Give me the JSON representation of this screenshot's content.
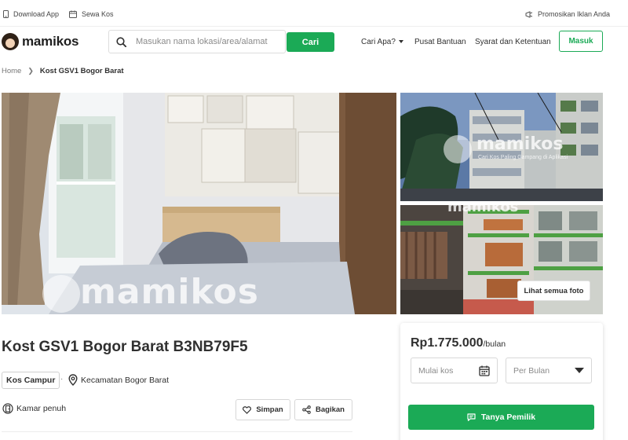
{
  "topbar": {
    "download_label": "Download App",
    "sewa_label": "Sewa Kos",
    "promo_label": "Promosikan Iklan Anda"
  },
  "header": {
    "logo_text": "mamikos",
    "search_placeholder": "Masukan nama lokasi/area/alamat",
    "search_button": "Cari",
    "nav": {
      "cari_apa": "Cari Apa?",
      "bantuan": "Pusat Bantuan",
      "syarat": "Syarat dan Ketentuan"
    },
    "login_button": "Masuk"
  },
  "breadcrumb": {
    "home": "Home",
    "current": "Kost GSV1 Bogor Barat"
  },
  "gallery": {
    "watermark": "mamikos",
    "watermark_tagline": "Cari Kos Paling Gampang di Aplikasi",
    "see_all_button": "Lihat semua foto"
  },
  "listing": {
    "title": "Kost GSV1 Bogor Barat B3NB79F5",
    "gender_tag": "Kos Campur",
    "separator": "·",
    "location": "Kecamatan Bogor Barat",
    "room_status": "Kamar penuh",
    "save_button": "Simpan",
    "share_button": "Bagikan"
  },
  "booking": {
    "price": "Rp1.775.000",
    "price_unit": "/bulan",
    "start_date_placeholder": "Mulai kos",
    "period_selected": "Per Bulan",
    "contact_button": "Tanya Pemilik"
  },
  "colors": {
    "brand_green": "#1baa56",
    "text_primary": "#303030",
    "text_muted": "#8a8a8a",
    "border": "#d8d8d8"
  }
}
